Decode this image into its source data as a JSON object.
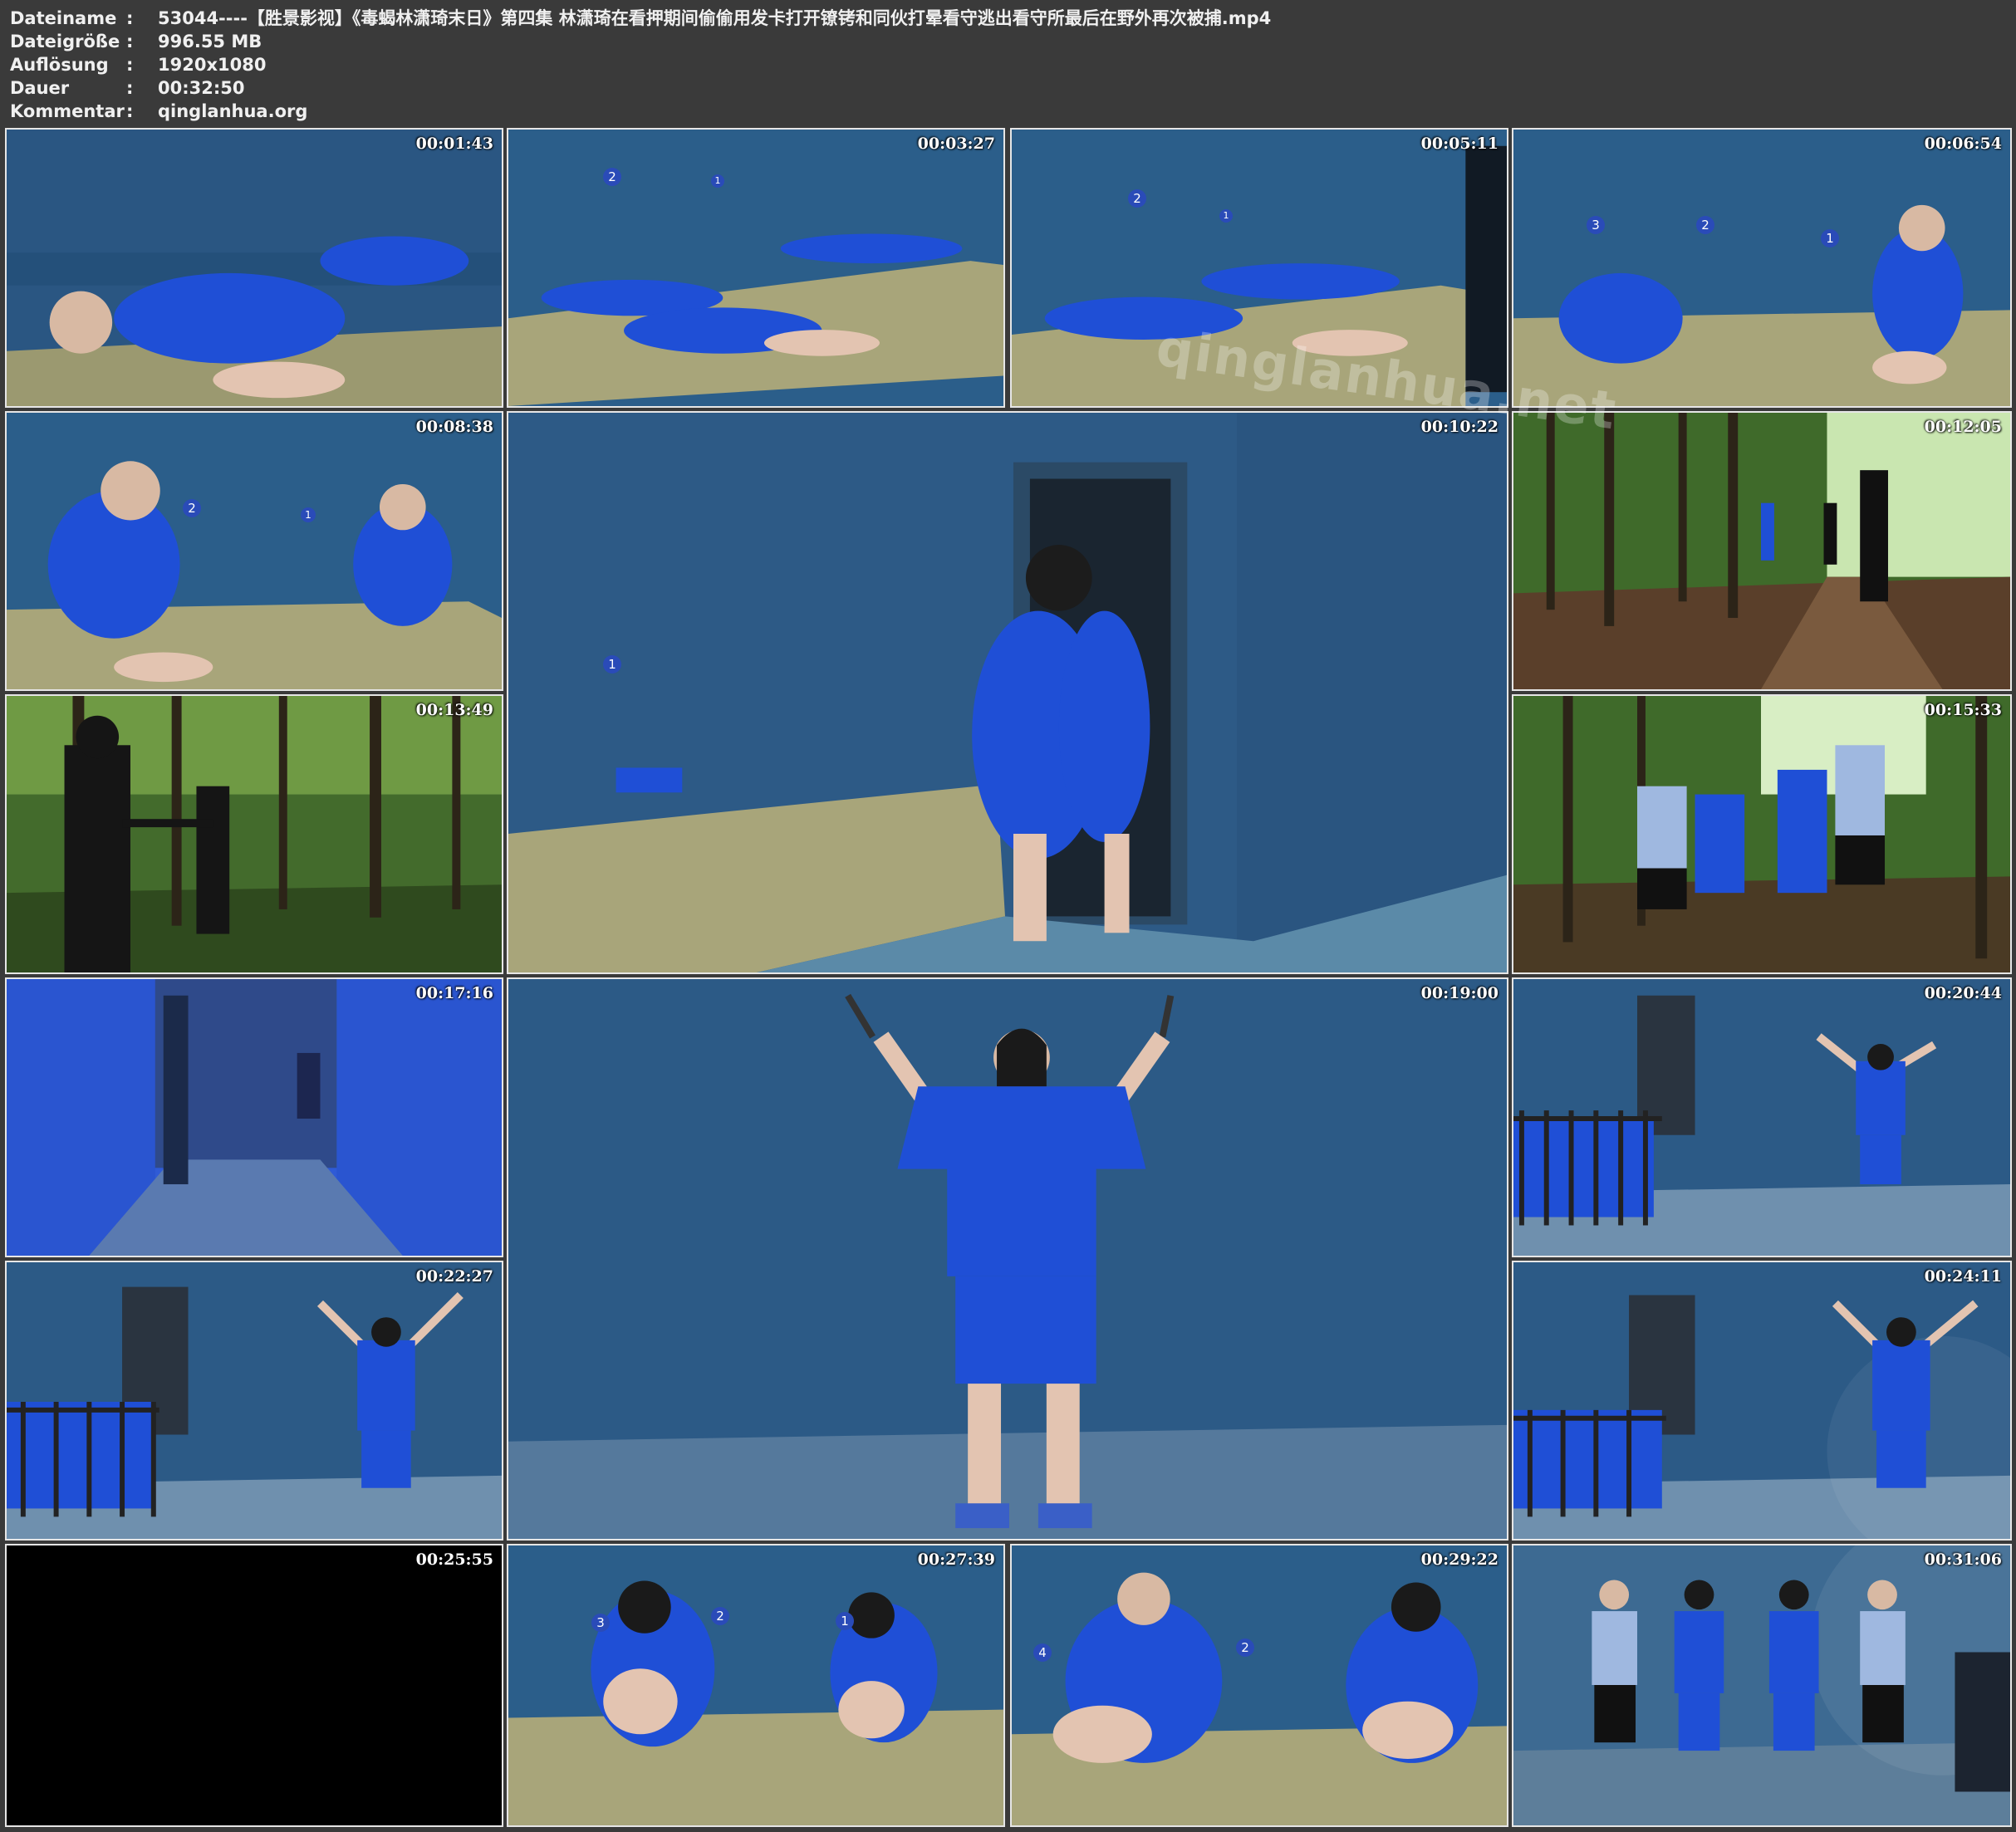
{
  "meta": {
    "rows": [
      {
        "key": "Dateiname",
        "value": "53044----【胜景影视】《毒蝎林潇琦末日》第四集 林潇琦在看押期间偷偷用发卡打开镣铐和同伙打晕看守逃出看守所最后在野外再次被捕.mp4"
      },
      {
        "key": "Dateigröße",
        "value": "996.55 MB"
      },
      {
        "key": "Auflösung",
        "value": "1920x1080"
      },
      {
        "key": "Dauer",
        "value": "00:32:50"
      },
      {
        "key": "Kommentar",
        "value": "qinglanhua.org"
      }
    ],
    "separator": ":"
  },
  "thumbnails": [
    {
      "time": "00:01:43",
      "scene": "cell-floor"
    },
    {
      "time": "00:03:27",
      "scene": "cell-floor"
    },
    {
      "time": "00:05:11",
      "scene": "cell-floor"
    },
    {
      "time": "00:06:54",
      "scene": "cell-corner"
    },
    {
      "time": "00:08:38",
      "scene": "cell-corner"
    },
    {
      "time": "00:10:22",
      "scene": "cell-door"
    },
    {
      "time": "00:12:05",
      "scene": "forest"
    },
    {
      "time": "00:13:49",
      "scene": "forest-dark"
    },
    {
      "time": "00:15:33",
      "scene": "forest"
    },
    {
      "time": "00:17:16",
      "scene": "corridor"
    },
    {
      "time": "00:19:00",
      "scene": "wall-chained"
    },
    {
      "time": "00:20:44",
      "scene": "wall-chained-small"
    },
    {
      "time": "00:22:27",
      "scene": "wall-chained-small"
    },
    {
      "time": "00:24:11",
      "scene": "wall-chained-small"
    },
    {
      "time": "00:25:55",
      "scene": "black"
    },
    {
      "time": "00:27:39",
      "scene": "seated"
    },
    {
      "time": "00:29:22",
      "scene": "seated"
    },
    {
      "time": "00:31:06",
      "scene": "lineup"
    }
  ],
  "watermark": "qinglanhua.net",
  "colors": {
    "background": "#3a3a3a",
    "wall": "#2c5a86",
    "uniform": "#1f4fd6",
    "mat": "#a8a57a",
    "forest": "#3f6a2a"
  }
}
